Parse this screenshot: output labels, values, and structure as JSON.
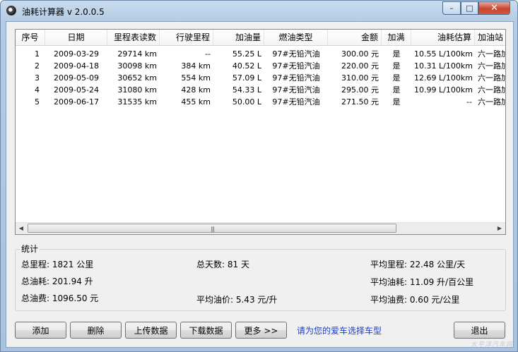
{
  "window": {
    "title": "油耗计算器 v 2.0.0.5",
    "close_glyph": "✕",
    "max_glyph": "□",
    "min_glyph": "–"
  },
  "table": {
    "columns": [
      "序号",
      "日期",
      "里程表读数",
      "行驶里程",
      "加油量",
      "燃油类型",
      "金额",
      "加满",
      "油耗估算",
      "加油站"
    ],
    "rows": [
      [
        "1",
        "2009-03-29",
        "29714 km",
        "--",
        "55.25 L",
        "97#无铅汽油",
        "300.00 元",
        "是",
        "10.55 L/100km",
        "六一路加"
      ],
      [
        "2",
        "2009-04-18",
        "30098 km",
        "384 km",
        "40.52 L",
        "97#无铅汽油",
        "220.00 元",
        "是",
        "10.31 L/100km",
        "六一路加"
      ],
      [
        "3",
        "2009-05-09",
        "30652 km",
        "554 km",
        "57.09 L",
        "97#无铅汽油",
        "310.00 元",
        "是",
        "12.69 L/100km",
        "六一路加"
      ],
      [
        "4",
        "2009-05-24",
        "31080 km",
        "428 km",
        "54.33 L",
        "97#无铅汽油",
        "295.00 元",
        "是",
        "10.99 L/100km",
        "六一路加"
      ],
      [
        "5",
        "2009-06-17",
        "31535 km",
        "455 km",
        "50.00 L",
        "97#无铅汽油",
        "271.50 元",
        "是",
        "--",
        "六一路加"
      ]
    ],
    "scroll_left": "◀",
    "scroll_right": "▶",
    "scroll_grip": "|||"
  },
  "stats": {
    "title": "统计",
    "total_mileage": "总里程: 1821 公里",
    "total_days": "总天数: 81 天",
    "avg_mileage": "平均里程: 22.48 公里/天",
    "total_fuel": "总油耗: 201.94 升",
    "avg_consumption": "平均油耗: 11.09 升/百公里",
    "total_cost": "总油费: 1096.50 元",
    "avg_price": "平均油价: 5.43 元/升",
    "avg_cost": "平均油费: 0.60 元/公里"
  },
  "buttons": {
    "add": "添加",
    "delete": "删除",
    "upload": "上传数据",
    "download": "下载数据",
    "more": "更多 >>",
    "exit": "退出"
  },
  "link_text": "请为您的爱车选择车型",
  "watermark": "太平洋汽车网"
}
